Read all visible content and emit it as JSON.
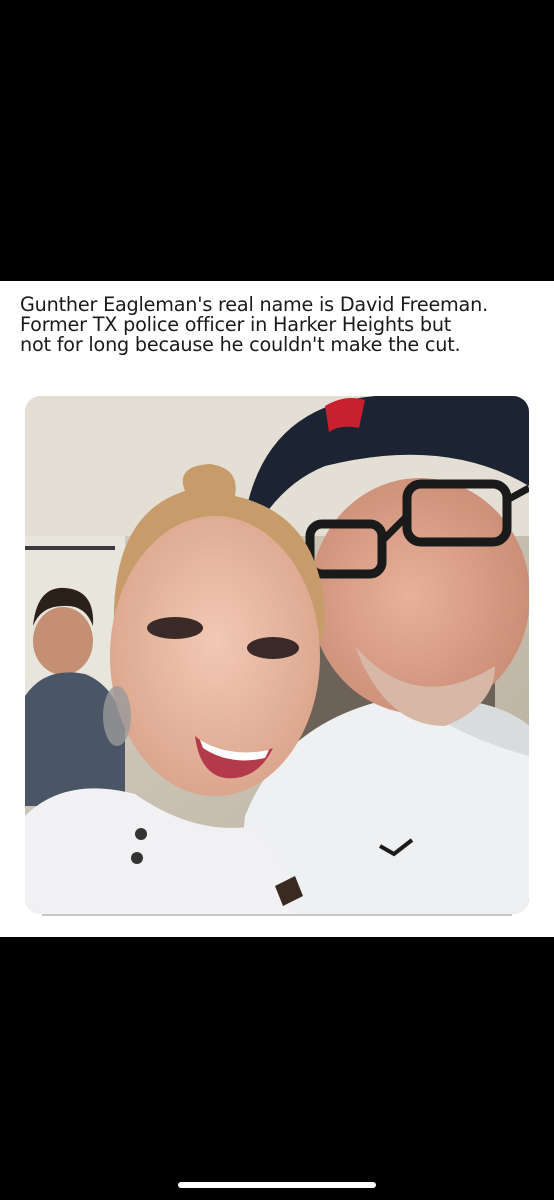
{
  "post": {
    "caption_lines": [
      "Gunther Eagleman's real name is David Freeman.",
      "Former TX police officer in Harker Heights but",
      "not for long because he couldn't make the cut."
    ]
  },
  "colors": {
    "background": "#000000",
    "card": "#ffffff",
    "text": "#1a1a1a",
    "cap": "#1c2433",
    "cap_logo": "#c8202f"
  },
  "icons": [
    "home-indicator"
  ]
}
